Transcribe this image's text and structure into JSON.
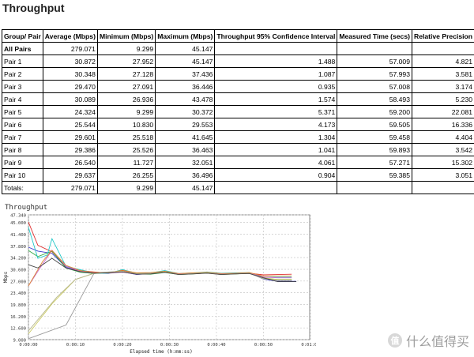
{
  "page_title": "Throughput",
  "table": {
    "headers": [
      "Group/ Pair",
      "Average (Mbps)",
      "Minimum (Mbps)",
      "Maximum (Mbps)",
      "Throughput 95% Confidence Interval",
      "Measured Time (secs)",
      "Relative Precision"
    ],
    "rows": [
      [
        "All Pairs",
        "279.071",
        "9.299",
        "45.147",
        "",
        "",
        ""
      ],
      [
        "Pair 1",
        "30.872",
        "27.952",
        "45.147",
        "1.488",
        "57.009",
        "4.821"
      ],
      [
        "Pair 2",
        "30.348",
        "27.128",
        "37.436",
        "1.087",
        "57.993",
        "3.581"
      ],
      [
        "Pair 3",
        "29.470",
        "27.091",
        "36.446",
        "0.935",
        "57.008",
        "3.174"
      ],
      [
        "Pair 4",
        "30.089",
        "26.936",
        "43.478",
        "1.574",
        "58.493",
        "5.230"
      ],
      [
        "Pair 5",
        "24.324",
        "9.299",
        "30.372",
        "5.371",
        "59.200",
        "22.081"
      ],
      [
        "Pair 6",
        "25.544",
        "10.830",
        "29.553",
        "4.173",
        "59.505",
        "16.336"
      ],
      [
        "Pair 7",
        "29.601",
        "25.518",
        "41.645",
        "1.304",
        "59.458",
        "4.404"
      ],
      [
        "Pair 8",
        "29.386",
        "25.526",
        "36.463",
        "1.041",
        "59.893",
        "3.542"
      ],
      [
        "Pair 9",
        "26.540",
        "11.727",
        "32.051",
        "4.061",
        "57.271",
        "15.302"
      ],
      [
        "Pair 10",
        "29.637",
        "26.255",
        "36.496",
        "0.904",
        "59.385",
        "3.051"
      ],
      [
        "Totals:",
        "279.071",
        "9.299",
        "45.147",
        "",
        "",
        ""
      ]
    ]
  },
  "chart_data": {
    "type": "line",
    "title": "Throughput",
    "xlabel": "Elapsed time (h:mm:ss)",
    "ylabel": "Mbps",
    "x_ticks": [
      "0:00:00",
      "0:00:10",
      "0:00:20",
      "0:00:30",
      "0:00:40",
      "0:00:50",
      "0:01:00"
    ],
    "y_ticks": [
      "9.000",
      "12.600",
      "16.200",
      "19.800",
      "23.400",
      "27.000",
      "30.600",
      "34.200",
      "37.800",
      "41.400",
      "45.000",
      "47.340"
    ],
    "xlim": [
      0,
      60
    ],
    "ylim": [
      9.0,
      47.34
    ],
    "grid": true,
    "series": [
      {
        "color": "#e03030",
        "points": [
          [
            0,
            45.1
          ],
          [
            2,
            38
          ],
          [
            5,
            36
          ],
          [
            8,
            31.5
          ],
          [
            11,
            30.2
          ],
          [
            14,
            29.8
          ],
          [
            17,
            29.4
          ],
          [
            20,
            30.2
          ],
          [
            23,
            29.3
          ],
          [
            26,
            29.4
          ],
          [
            29,
            29.8
          ],
          [
            32,
            29.1
          ],
          [
            35,
            29.3
          ],
          [
            38,
            29.6
          ],
          [
            41,
            29.1
          ],
          [
            44,
            29.3
          ],
          [
            47,
            29.4
          ],
          [
            50,
            28.9
          ],
          [
            53,
            29.0
          ],
          [
            56,
            29.1
          ]
        ]
      },
      {
        "color": "#3b3bcc",
        "points": [
          [
            0,
            37.4
          ],
          [
            2,
            36.2
          ],
          [
            5,
            35.5
          ],
          [
            8,
            31.2
          ],
          [
            11,
            29.9
          ],
          [
            14,
            29.5
          ],
          [
            17,
            29.6
          ],
          [
            20,
            29.8
          ],
          [
            23,
            29.0
          ],
          [
            26,
            29.3
          ],
          [
            29,
            29.8
          ],
          [
            32,
            29.1
          ],
          [
            35,
            29.4
          ],
          [
            38,
            29.6
          ],
          [
            41,
            29.0
          ],
          [
            44,
            29.3
          ],
          [
            47,
            29.5
          ],
          [
            50,
            27.6
          ],
          [
            53,
            26.9
          ],
          [
            57,
            26.9
          ]
        ]
      },
      {
        "color": "#33aa44",
        "points": [
          [
            0,
            36.4
          ],
          [
            2,
            34.5
          ],
          [
            5,
            36.2
          ],
          [
            8,
            31.0
          ],
          [
            11,
            29.7
          ],
          [
            14,
            29.3
          ],
          [
            17,
            29.6
          ],
          [
            20,
            29.9
          ],
          [
            23,
            29.2
          ],
          [
            26,
            29.1
          ],
          [
            29,
            29.6
          ],
          [
            32,
            29.0
          ],
          [
            35,
            29.2
          ],
          [
            38,
            29.5
          ],
          [
            41,
            29.1
          ],
          [
            44,
            29.2
          ],
          [
            47,
            29.4
          ],
          [
            50,
            27.8
          ],
          [
            53,
            27.5
          ],
          [
            56,
            27.5
          ]
        ]
      },
      {
        "color": "#20c8c8",
        "points": [
          [
            0,
            43.5
          ],
          [
            2,
            34
          ],
          [
            4,
            35
          ],
          [
            5,
            40
          ],
          [
            8,
            31.5
          ],
          [
            11,
            30.5
          ],
          [
            14,
            29.5
          ],
          [
            17,
            29.3
          ],
          [
            20,
            30.5
          ],
          [
            23,
            29.4
          ],
          [
            26,
            29.5
          ],
          [
            29,
            30.2
          ],
          [
            32,
            29.3
          ],
          [
            35,
            29.5
          ],
          [
            38,
            29.8
          ],
          [
            41,
            29.4
          ],
          [
            44,
            29.5
          ],
          [
            47,
            29.6
          ],
          [
            50,
            28.2
          ],
          [
            53,
            28.2
          ],
          [
            56,
            28.2
          ]
        ]
      },
      {
        "color": "#999999",
        "points": [
          [
            0,
            9.3
          ],
          [
            8,
            13.5
          ],
          [
            14,
            29.5
          ],
          [
            17,
            29.8
          ],
          [
            20,
            30.0
          ],
          [
            23,
            29.3
          ],
          [
            26,
            29.4
          ],
          [
            29,
            29.9
          ],
          [
            32,
            29.1
          ],
          [
            35,
            29.4
          ],
          [
            38,
            29.6
          ],
          [
            41,
            29.1
          ],
          [
            44,
            29.3
          ],
          [
            47,
            29.5
          ],
          [
            50,
            27.9
          ],
          [
            53,
            27.2
          ],
          [
            56,
            27.2
          ]
        ]
      },
      {
        "color": "#cccc66",
        "points": [
          [
            0,
            10.8
          ],
          [
            5,
            20
          ],
          [
            10,
            27.5
          ],
          [
            14,
            29.4
          ],
          [
            17,
            29.6
          ],
          [
            20,
            29.9
          ],
          [
            23,
            29.2
          ],
          [
            26,
            29.3
          ],
          [
            29,
            29.8
          ],
          [
            32,
            29.0
          ],
          [
            35,
            29.3
          ],
          [
            38,
            29.5
          ],
          [
            41,
            29.0
          ],
          [
            44,
            29.2
          ],
          [
            47,
            29.4
          ],
          [
            50,
            28.0
          ],
          [
            53,
            27.5
          ],
          [
            56,
            27.5
          ]
        ]
      },
      {
        "color": "#cc66cc",
        "points": [
          [
            0,
            25.5
          ],
          [
            2,
            30
          ],
          [
            5,
            36.5
          ],
          [
            8,
            31.5
          ],
          [
            11,
            30.0
          ],
          [
            14,
            29.6
          ],
          [
            17,
            29.4
          ],
          [
            20,
            29.7
          ],
          [
            23,
            29.1
          ],
          [
            26,
            29.3
          ],
          [
            29,
            29.7
          ],
          [
            32,
            29.2
          ],
          [
            35,
            29.3
          ],
          [
            38,
            29.4
          ],
          [
            41,
            29.2
          ],
          [
            44,
            29.4
          ],
          [
            47,
            29.5
          ],
          [
            50,
            28.2
          ],
          [
            53,
            28.0
          ],
          [
            56,
            28.0
          ]
        ]
      },
      {
        "color": "#dd8833",
        "points": [
          [
            0,
            25.5
          ],
          [
            3,
            33
          ],
          [
            5,
            36.4
          ],
          [
            8,
            31.8
          ],
          [
            11,
            30.2
          ],
          [
            14,
            29.7
          ],
          [
            17,
            29.5
          ],
          [
            20,
            30.3
          ],
          [
            23,
            29.5
          ],
          [
            26,
            29.6
          ],
          [
            29,
            30.0
          ],
          [
            32,
            29.3
          ],
          [
            35,
            29.5
          ],
          [
            38,
            29.7
          ],
          [
            41,
            29.3
          ],
          [
            44,
            29.4
          ],
          [
            47,
            29.6
          ],
          [
            50,
            28.5
          ],
          [
            53,
            28.5
          ],
          [
            56,
            28.5
          ]
        ]
      },
      {
        "color": "#b8b890",
        "points": [
          [
            0,
            11.7
          ],
          [
            6,
            22
          ],
          [
            10,
            27.5
          ],
          [
            14,
            29.4
          ],
          [
            17,
            29.7
          ],
          [
            20,
            30.0
          ],
          [
            23,
            29.2
          ],
          [
            26,
            29.3
          ],
          [
            29,
            29.8
          ],
          [
            32,
            29.0
          ],
          [
            35,
            29.3
          ],
          [
            38,
            29.5
          ],
          [
            41,
            29.0
          ],
          [
            44,
            29.2
          ],
          [
            47,
            29.4
          ],
          [
            50,
            27.7
          ],
          [
            53,
            27.3
          ],
          [
            56,
            27.3
          ]
        ]
      },
      {
        "color": "#444444",
        "points": [
          [
            0,
            32
          ],
          [
            2,
            31
          ],
          [
            5,
            34
          ],
          [
            8,
            31.0
          ],
          [
            11,
            29.9
          ],
          [
            14,
            29.4
          ],
          [
            17,
            29.5
          ],
          [
            20,
            29.8
          ],
          [
            23,
            29.1
          ],
          [
            26,
            29.2
          ],
          [
            29,
            29.7
          ],
          [
            32,
            29.0
          ],
          [
            35,
            29.2
          ],
          [
            38,
            29.4
          ],
          [
            41,
            29.0
          ],
          [
            44,
            29.2
          ],
          [
            47,
            29.3
          ],
          [
            50,
            28.0
          ],
          [
            53,
            26.8
          ],
          [
            57,
            26.8
          ]
        ]
      }
    ]
  },
  "watermark": {
    "icon_glyph": "值",
    "text": "什么值得买"
  }
}
